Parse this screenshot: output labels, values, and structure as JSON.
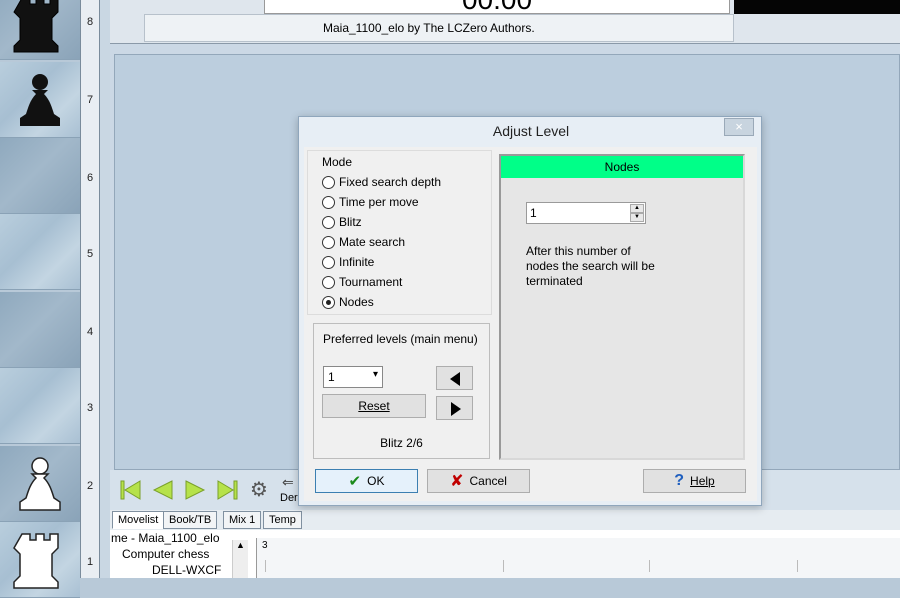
{
  "board": {
    "ranks": [
      "8",
      "7",
      "6",
      "5",
      "4",
      "3",
      "2",
      "1"
    ]
  },
  "engine_panel": {
    "clock": "00:00",
    "credit": "Maia_1100_elo by The LCZero Authors."
  },
  "nav": {
    "demo_label": "Der"
  },
  "tabs": [
    "Movelist",
    "Book/TB",
    "Mix 1",
    "Temp"
  ],
  "game_header": {
    "line1": "me - Maia_1100_elo",
    "line2": "Computer chess",
    "line3": "DELL-WXCF"
  },
  "ruler": {
    "label": "3"
  },
  "dialog": {
    "title": "Adjust Level",
    "close": "×",
    "mode_label": "Mode",
    "modes": [
      "Fixed search depth",
      "Time per move",
      "Blitz",
      "Mate search",
      "Infinite",
      "Tournament",
      "Nodes"
    ],
    "selected_mode": "Nodes",
    "preferred_label": "Preferred levels (main menu)",
    "preferred_value": "1",
    "reset_label": "Reset",
    "blitz_status": "Blitz 2/6",
    "panel_header": "Nodes",
    "nodes_value": "1",
    "nodes_description": "After this number of nodes the search will be terminated",
    "ok_label": "OK",
    "cancel_label": "Cancel",
    "help_label": "Help"
  },
  "colors": {
    "panel_header": "#00ff88",
    "ok_check": "#1a8a1a",
    "cancel_x": "#c00000",
    "help_q": "#1f5fbf",
    "nav_arrow": "#b6e24a"
  }
}
